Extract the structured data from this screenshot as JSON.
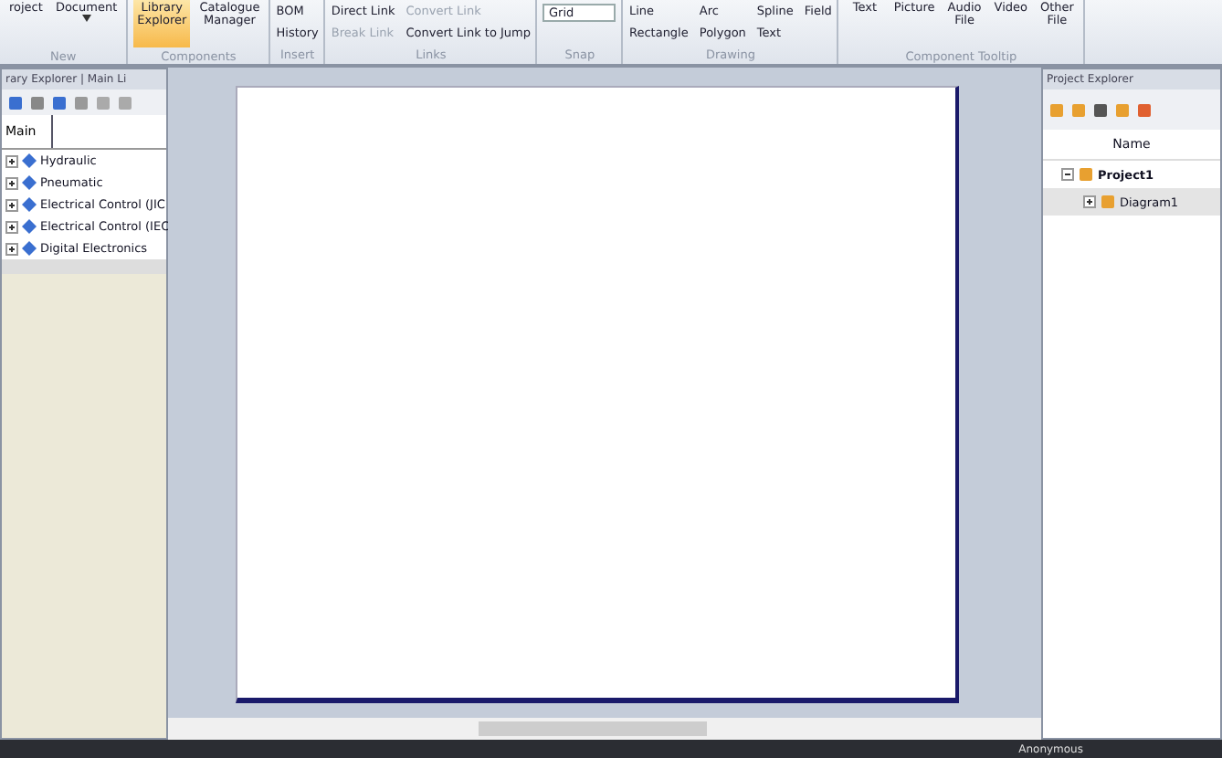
{
  "ribbon": {
    "groups": [
      {
        "label": "New",
        "items": [
          {
            "label": "roject",
            "kind": "large"
          },
          {
            "label": "Document",
            "kind": "large",
            "caret": true
          }
        ]
      },
      {
        "label": "Components",
        "items": [
          {
            "label": "Library Explorer",
            "kind": "large",
            "selected": true
          },
          {
            "label": "Catalogue Manager",
            "kind": "large",
            "selected": false
          }
        ]
      },
      {
        "label": "Insert",
        "items": [
          {
            "label": "BOM",
            "kind": "small"
          },
          {
            "label": "History",
            "kind": "small"
          }
        ]
      },
      {
        "label": "Links",
        "items": [
          {
            "label": "Direct Link",
            "kind": "small",
            "disabled": false
          },
          {
            "label": "Break Link",
            "kind": "small",
            "disabled": true
          },
          {
            "label": "Convert Link",
            "kind": "small",
            "disabled": true
          },
          {
            "label": "Convert Link to Jump",
            "kind": "small",
            "disabled": false
          }
        ]
      },
      {
        "label": "Snap",
        "items": [
          {
            "label": "Grid",
            "kind": "dropdown"
          }
        ]
      },
      {
        "label": "Drawing",
        "items": [
          {
            "label": "Line",
            "kind": "small"
          },
          {
            "label": "Rectangle",
            "kind": "small"
          },
          {
            "label": "Arc",
            "kind": "small"
          },
          {
            "label": "Polygon",
            "kind": "small"
          },
          {
            "label": "Spline",
            "kind": "small"
          },
          {
            "label": "Text",
            "kind": "small"
          },
          {
            "label": "Field",
            "kind": "small"
          }
        ]
      },
      {
        "label": "Component Tooltip",
        "items": [
          {
            "label": "Text",
            "kind": "large"
          },
          {
            "label": "Picture",
            "kind": "large"
          },
          {
            "label": "Audio File",
            "kind": "large"
          },
          {
            "label": "Video",
            "kind": "large"
          },
          {
            "label": "Other File",
            "kind": "large"
          }
        ]
      }
    ]
  },
  "library_explorer": {
    "title": "rary Explorer | Main Li",
    "tabs": [
      {
        "label": "Main",
        "selected": true
      }
    ],
    "items": [
      {
        "label": "Hydraulic",
        "expanded": false
      },
      {
        "label": "Pneumatic",
        "expanded": false
      },
      {
        "label": "Electrical Control (JIC",
        "expanded": false
      },
      {
        "label": "Electrical Control (IEC",
        "expanded": false
      },
      {
        "label": "Digital Electronics",
        "expanded": false
      }
    ]
  },
  "project_explorer": {
    "title": "Project Explorer",
    "column": "Name",
    "tree": [
      {
        "label": "Project1",
        "expanded": true,
        "selected": false,
        "children": [
          {
            "label": "Diagram1",
            "expanded": false,
            "selected": true
          }
        ]
      }
    ]
  },
  "status_bar": {
    "user": "Anonymous"
  }
}
